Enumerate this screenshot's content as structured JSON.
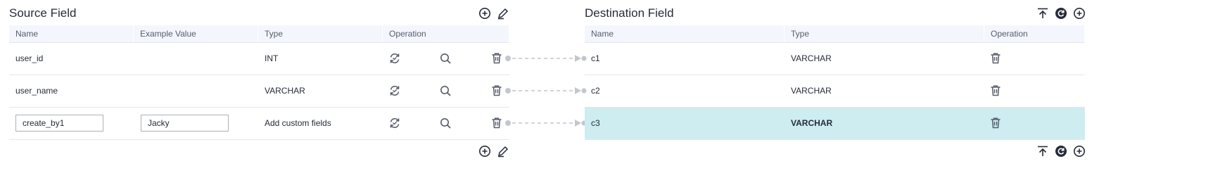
{
  "source": {
    "title": "Source Field",
    "columns": [
      "Name",
      "Example Value",
      "Type",
      "Operation"
    ],
    "rows": [
      {
        "name": "user_id",
        "example": "",
        "type": "INT",
        "editable": false
      },
      {
        "name": "user_name",
        "example": "",
        "type": "VARCHAR",
        "editable": false
      },
      {
        "name": "create_by1",
        "example": "Jacky",
        "type": "Add custom fields",
        "editable": true
      }
    ]
  },
  "destination": {
    "title": "Destination Field",
    "columns": [
      "Name",
      "Type",
      "Operation"
    ],
    "rows": [
      {
        "name": "c1",
        "type": "VARCHAR",
        "selected": false
      },
      {
        "name": "c2",
        "type": "VARCHAR",
        "selected": false
      },
      {
        "name": "c3",
        "type": "VARCHAR",
        "selected": true
      }
    ]
  },
  "icons": {
    "source_top": [
      "add-circle-icon",
      "edit-pen-icon"
    ],
    "source_bottom": [
      "add-circle-icon",
      "edit-pen-icon"
    ],
    "destination_top": [
      "import-upload-icon",
      "refresh-icon",
      "add-circle-icon"
    ],
    "destination_bottom": [
      "import-upload-icon",
      "refresh-icon",
      "add-circle-icon"
    ],
    "row_operations": [
      "convert-icon",
      "search-icon",
      "delete-icon"
    ]
  },
  "colors": {
    "selected_row": "#cdedf0",
    "header_bg": "#f3f6fc",
    "connector": "#c2c6cf",
    "icon": "#575d6c"
  }
}
